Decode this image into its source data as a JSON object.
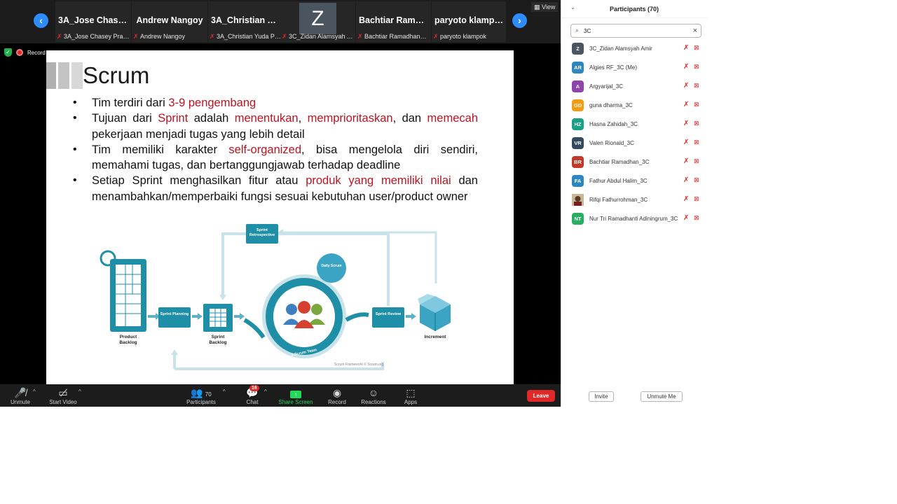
{
  "strip": {
    "prev_icon": "chevron-left-icon",
    "next_icon": "chevron-right-icon",
    "view_label": "View",
    "tiles": [
      {
        "name": "3A_Jose  Chasey...",
        "label": "3A_Jose Chasey Prata..."
      },
      {
        "name": "Andrew Nangoy",
        "label": "Andrew Nangoy"
      },
      {
        "name": "3A_Christian  Yu...",
        "label": "3A_Christian Yuda Prat..."
      },
      {
        "avatar": "Z",
        "label": "3C_Zidan Alamsyah A..."
      },
      {
        "name": "Bachtiar  Ramad...",
        "label": "Bachtiar Ramadhan_3C"
      },
      {
        "name": "paryoto klampok",
        "label": "paryoto klampok"
      }
    ]
  },
  "indicators": {
    "record_text": "Record"
  },
  "slide": {
    "title": "Scrum",
    "b1": {
      "t1": "Tim terdiri dari ",
      "r1": "3-9 pengembang"
    },
    "b2": {
      "t1": "Tujuan dari ",
      "r1": "Sprint",
      "t2": " adalah ",
      "r2": "menentukan",
      "t3": ", ",
      "r3": "memprioritaskan",
      "t4": ", dan ",
      "r4": "memecah",
      "t5": " pekerjaan yang lebih detail",
      "t5a": " pekerjaan menjadi tugas yang lebih detail"
    },
    "b3": {
      "t1": "Tim memiliki karakter ",
      "r1": "self-organized",
      "t2": ", bisa mengelola diri sendiri, memahami tugas, dan bertanggungjawab terhadap deadline"
    },
    "b4": {
      "t1": "Setiap Sprint menghasilkan fitur atau ",
      "r1": "produk yang memiliki nilai",
      "t2": " dan menambahkan/memperbaiki fungsi sesuai kebutuhan user/product owner"
    },
    "diagram": {
      "retrospective": "Sprint Retrospective",
      "daily": "Daily Scrum",
      "planning": "Sprint Planning",
      "review": "Sprint Review",
      "product_backlog": "Product Backlog",
      "sprint_backlog": "Sprint Backlog",
      "increment": "Increment",
      "team": "1 Scrum Team",
      "credit": "Scrum Framework © Scrum.org",
      "colors": {
        "teal": "#1f8fa8",
        "light": "#c9e3ea"
      }
    }
  },
  "toolbar": {
    "unmute": "Unmute",
    "start_video": "Start Video",
    "participants": "Participants",
    "participants_count": "70",
    "chat": "Chat",
    "chat_badge": "16",
    "share_screen": "Share Screen",
    "record": "Record",
    "reactions": "Reactions",
    "apps": "Apps",
    "leave": "Leave",
    "colors": {
      "share": "#23d959",
      "leave": "#e02828"
    }
  },
  "panel": {
    "title": "Participants (70)",
    "search_value": "3C",
    "participants": [
      {
        "initials": "Z",
        "name": "3C_Zidan Alamsyah Amir",
        "color": "#4a5560"
      },
      {
        "initials": "AR",
        "name": "Algies RF_3C (Me)",
        "color": "#2e86c1"
      },
      {
        "initials": "A",
        "name": "Argyarijal_3C",
        "color": "#8e44ad"
      },
      {
        "initials": "GD",
        "name": "guna dharma_3C",
        "color": "#f39c12"
      },
      {
        "initials": "HZ",
        "name": "Hasna Zahidah_3C",
        "color": "#16a085"
      },
      {
        "initials": "VR",
        "name": "Valen Rionald_3C",
        "color": "#34495e"
      },
      {
        "initials": "BR",
        "name": "Bachtiar Ramadhan_3C",
        "color": "#c0392b"
      },
      {
        "initials": "FA",
        "name": "Fathur Abdul Halim_3C",
        "color": "#2e86c1"
      },
      {
        "initials": "",
        "name": "Rifqi Fathurrohman_3C",
        "color": "#a05a3c"
      },
      {
        "initials": "NT",
        "name": "Nur Tri Ramadhanti Adiningrum_3C",
        "color": "#27ae60"
      }
    ],
    "invite": "Invite",
    "unmute_me": "Unmute Me"
  }
}
